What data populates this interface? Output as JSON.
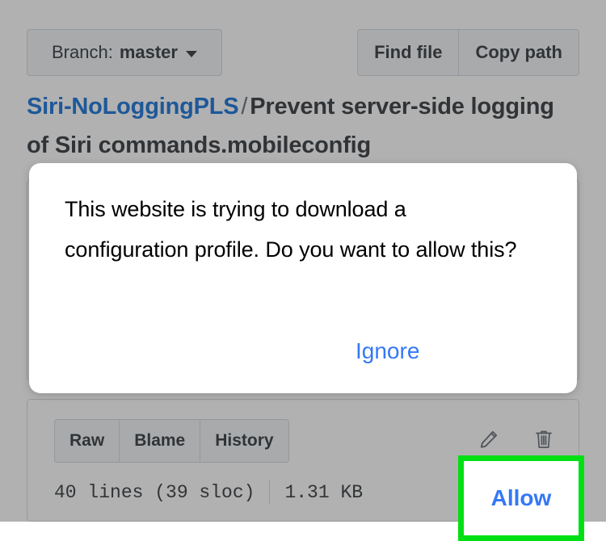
{
  "page": {
    "branch_button": {
      "prefix": "Branch:",
      "value": "master",
      "caret_icon": "chevron-down-icon"
    },
    "top_actions": [
      {
        "label": "Find file"
      },
      {
        "label": "Copy path"
      }
    ],
    "breadcrumb": {
      "repo": "Siri-NoLoggingPLS",
      "separator": "/",
      "filename": "Prevent server-side logging of Siri commands.mobileconfig"
    },
    "file_actions": {
      "view_buttons": [
        {
          "label": "Raw"
        },
        {
          "label": "Blame"
        },
        {
          "label": "History"
        }
      ],
      "icons": [
        {
          "name": "pencil-icon",
          "title": "Edit this file"
        },
        {
          "name": "trash-icon",
          "title": "Delete this file"
        }
      ],
      "meta": {
        "lines": "40 lines (39 sloc)",
        "size": "1.31 KB"
      }
    },
    "colors": {
      "link_blue": "#0366d6",
      "text": "#24292e",
      "button_bg": "#eff3f6",
      "border": "#d1d5da"
    }
  },
  "dialog": {
    "message": "This website is trying to download a configuration profile. Do you want to allow this?",
    "ignore_label": "Ignore",
    "allow_label": "Allow",
    "action_color": "#3478f6",
    "highlight_color": "#00e013"
  }
}
